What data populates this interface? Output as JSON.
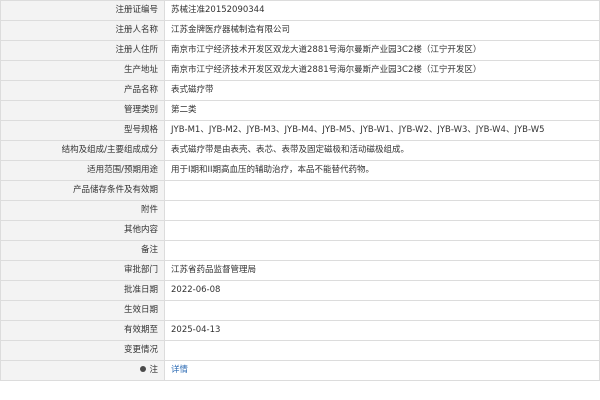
{
  "rows": [
    {
      "label": "注册证编号",
      "value": "苏械注准20152090344"
    },
    {
      "label": "注册人名称",
      "value": "江苏金牌医疗器械制造有限公司"
    },
    {
      "label": "注册人住所",
      "value": "南京市江宁经济技术开发区双龙大道2881号海尔曼斯产业园3C2楼（江宁开发区）"
    },
    {
      "label": "生产地址",
      "value": "南京市江宁经济技术开发区双龙大道2881号海尔曼斯产业园3C2楼（江宁开发区）"
    },
    {
      "label": "产品名称",
      "value": "表式磁疗带"
    },
    {
      "label": "管理类别",
      "value": "第二类"
    },
    {
      "label": "型号规格",
      "value": "JYB-M1、JYB-M2、JYB-M3、JYB-M4、JYB-M5、JYB-W1、JYB-W2、JYB-W3、JYB-W4、JYB-W5"
    },
    {
      "label": "结构及组成/主要组成成分",
      "value": "表式磁疗带是由表壳、表芯、表带及固定磁极和活动磁极组成。"
    },
    {
      "label": "适用范围/预期用途",
      "value": "用于I期和II期高血压的辅助治疗，本品不能替代药物。"
    },
    {
      "label": "产品储存条件及有效期",
      "value": ""
    },
    {
      "label": "附件",
      "value": ""
    },
    {
      "label": "其他内容",
      "value": ""
    },
    {
      "label": "备注",
      "value": ""
    },
    {
      "label": "审批部门",
      "value": "江苏省药品监督管理局"
    },
    {
      "label": "批准日期",
      "value": "2022-06-08"
    },
    {
      "label": "生效日期",
      "value": ""
    },
    {
      "label": "有效期至",
      "value": "2025-04-13"
    },
    {
      "label": "变更情况",
      "value": ""
    }
  ],
  "note": {
    "label": "注",
    "icon": "location-pin-icon",
    "link_text": "详情"
  }
}
